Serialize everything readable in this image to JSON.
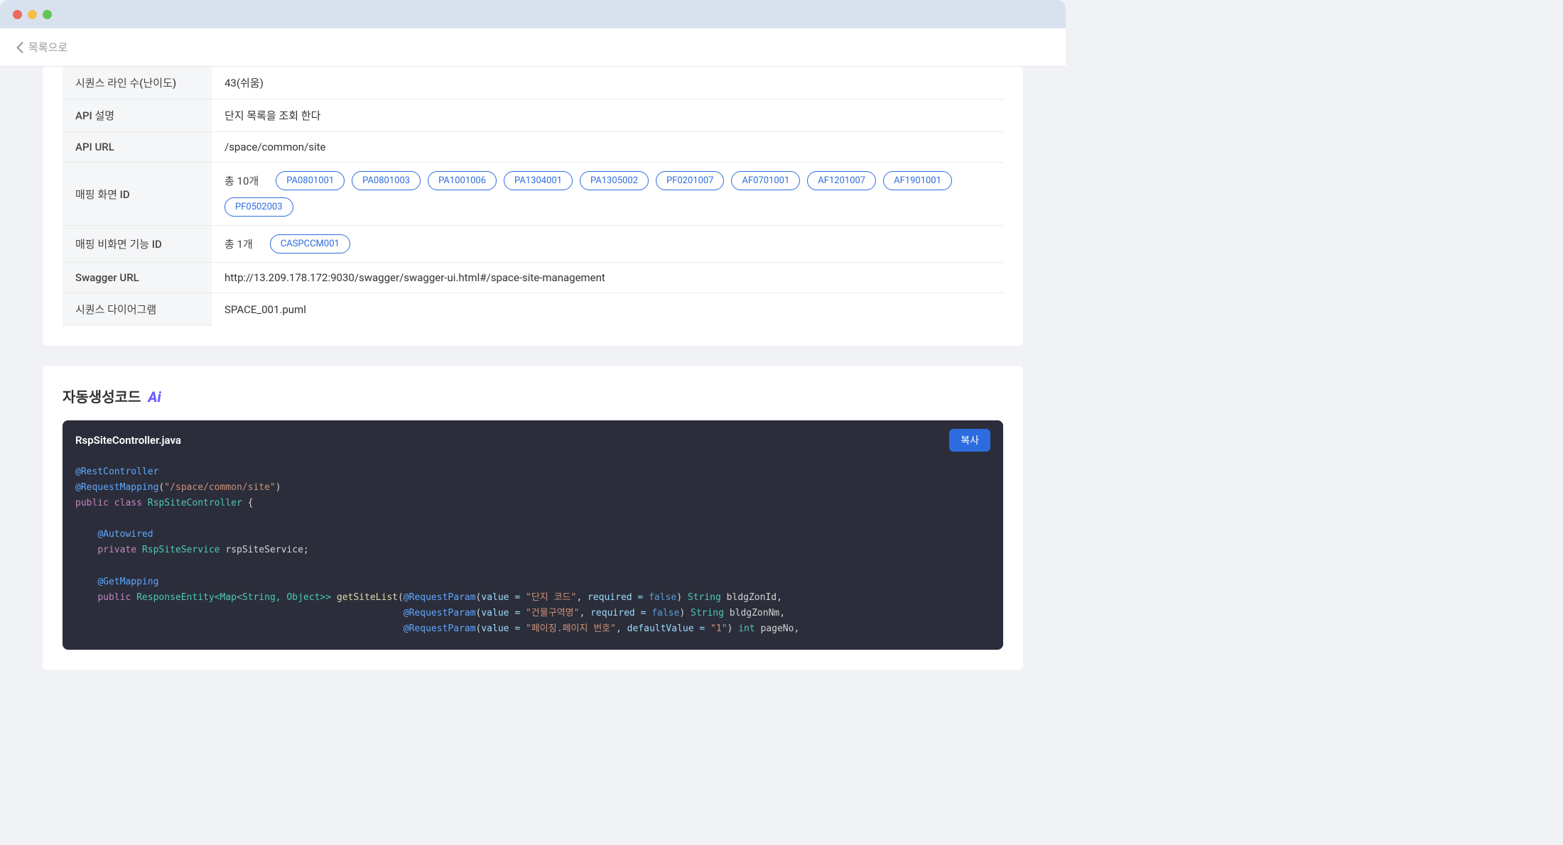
{
  "topbar": {
    "back_label": "목록으로"
  },
  "detail": {
    "rows": {
      "seq_lines": {
        "label": "시퀀스 라인 수(난이도)",
        "value": "43(쉬움)"
      },
      "api_desc": {
        "label": "API 설명",
        "value": "단지 목록을 조회 한다"
      },
      "api_url": {
        "label": "API URL",
        "value": "/space/common/site"
      },
      "map_screen": {
        "label": "매핑 화면 ID",
        "count_text": "총 10개",
        "chips": [
          "PA0801001",
          "PA0801003",
          "PA1001006",
          "PA1304001",
          "PA1305002",
          "PF0201007",
          "AF0701001",
          "AF1201007",
          "AF1901001",
          "PF0502003"
        ]
      },
      "map_nonscreen": {
        "label": "매핑 비화면 기능 ID",
        "count_text": "총 1개",
        "chips": [
          "CASPCCM001"
        ]
      },
      "swagger": {
        "label": "Swagger URL",
        "value": "http://13.209.178.172:9030/swagger/swagger-ui.html#/space-site-management"
      },
      "seq_diagram": {
        "label": "시퀀스 다이어그램",
        "value": "SPACE_001.puml"
      }
    }
  },
  "code_section": {
    "title": "자동생성코드",
    "ai_badge": "Ai",
    "filename": "RspSiteController.java",
    "copy_label": "복사",
    "tokens": {
      "ann_restcontroller": "@RestController",
      "ann_reqmapping": "@RequestMapping",
      "reqmapping_val": "\"/space/common/site\"",
      "kw_public": "public",
      "kw_class": "class",
      "class_name": "RspSiteController",
      "ann_autowired": "@Autowired",
      "kw_private": "private",
      "svc_type": "RspSiteService",
      "svc_field": "rspSiteService;",
      "ann_getmapping": "@GetMapping",
      "ret_type": "ResponseEntity<Map<String, Object>>",
      "method_name": "getSiteList",
      "ann_reqparam": "@RequestParam",
      "p1_value_lit": "\"단지 코드\"",
      "p1_req_kv": "required = ",
      "p1_req_bool": "false",
      "p1_type": "String",
      "p1_name": "bldgZonId,",
      "p2_value_lit": "\"건물구역명\"",
      "p2_req_kv": "required = ",
      "p2_req_bool": "false",
      "p2_type": "String",
      "p2_name": "bldgZonNm,",
      "p3_value_lit": "\"페이징.페이지 번호\"",
      "p3_def_kv": "defaultValue = ",
      "p3_def_lit": "\"1\"",
      "p3_type": "int",
      "p3_name": "pageNo,",
      "value_label": "value = "
    }
  }
}
